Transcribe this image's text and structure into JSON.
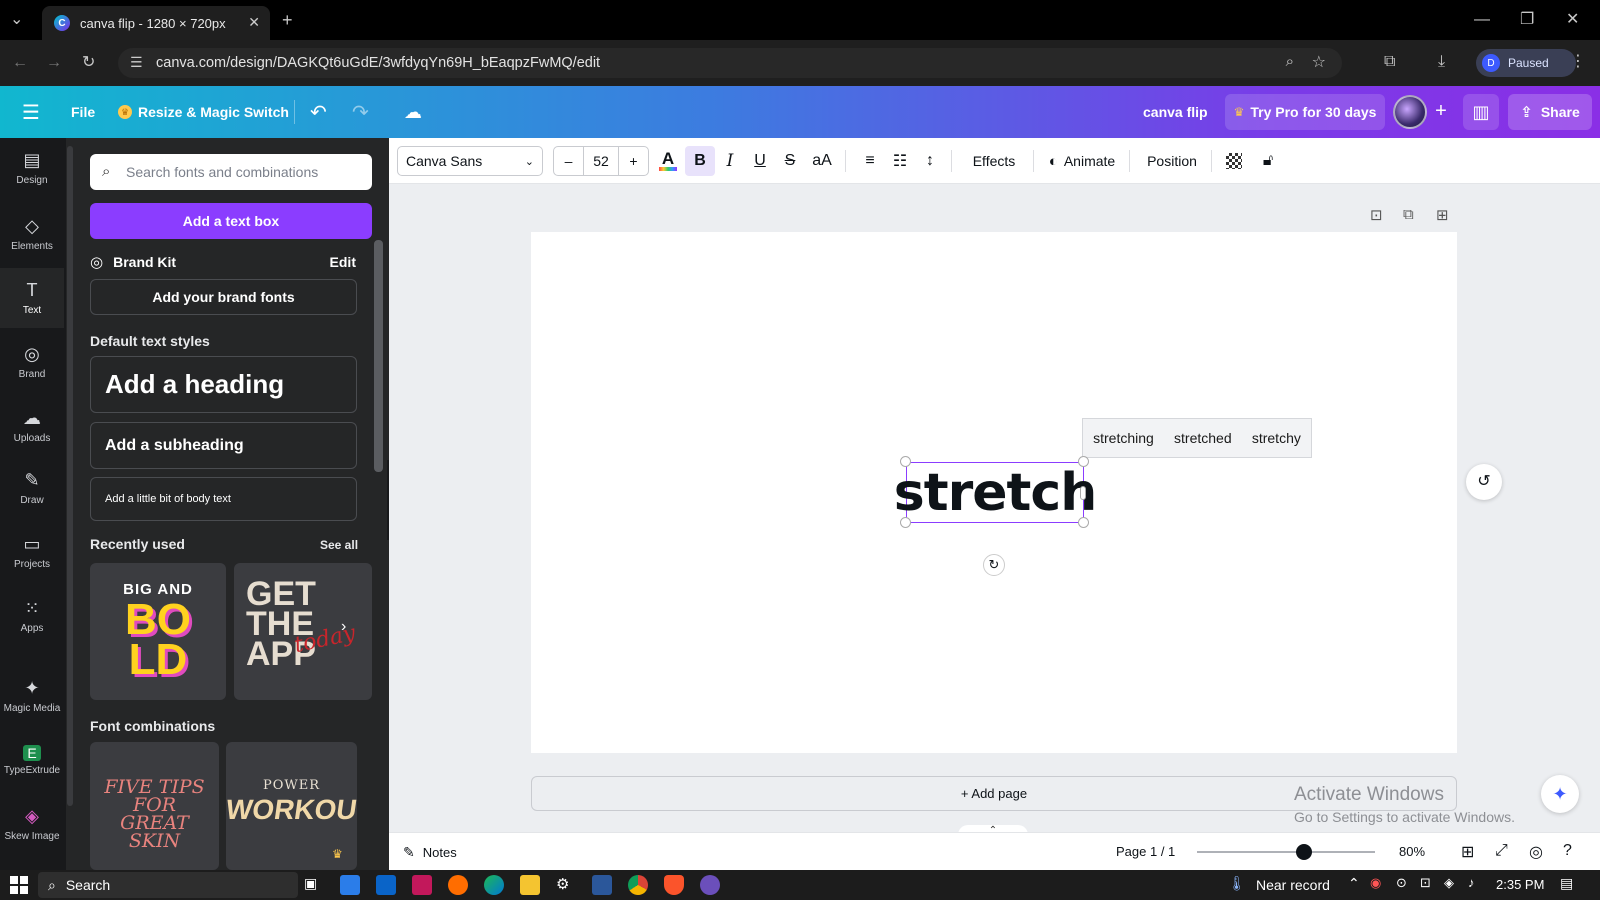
{
  "browser": {
    "tab_title": "canva flip - 1280 × 720px",
    "url": "canva.com/design/DAGKQt6uGdE/3wfdyqYn69H_bEaqpzFwMQ/edit",
    "profile_initial": "D",
    "profile_status": "Paused"
  },
  "header": {
    "file_label": "File",
    "resize_label": "Resize & Magic Switch",
    "design_title": "canva flip",
    "try_pro_label": "Try Pro for 30 days",
    "share_label": "Share"
  },
  "rail": [
    {
      "name": "design",
      "label": "Design",
      "icon": "▤"
    },
    {
      "name": "elements",
      "label": "Elements",
      "icon": "◇"
    },
    {
      "name": "text",
      "label": "Text",
      "icon": "T"
    },
    {
      "name": "brand",
      "label": "Brand",
      "icon": "◎"
    },
    {
      "name": "uploads",
      "label": "Uploads",
      "icon": "☁"
    },
    {
      "name": "draw",
      "label": "Draw",
      "icon": "✎"
    },
    {
      "name": "projects",
      "label": "Projects",
      "icon": "▭"
    },
    {
      "name": "apps",
      "label": "Apps",
      "icon": "⁙"
    },
    {
      "name": "magic-media",
      "label": "Magic Media",
      "icon": "✦"
    },
    {
      "name": "typeextrude",
      "label": "TypeExtrude",
      "icon": "E"
    },
    {
      "name": "skew-image",
      "label": "Skew Image",
      "icon": "◈"
    }
  ],
  "panel": {
    "search_placeholder": "Search fonts and combinations",
    "add_text_box": "Add a text box",
    "brand_kit": "Brand Kit",
    "brand_edit": "Edit",
    "add_brand_fonts": "Add your brand fonts",
    "default_styles": "Default text styles",
    "heading": "Add a heading",
    "subheading": "Add a subheading",
    "body": "Add a little bit of body text",
    "recently_used": "Recently used",
    "see_all": "See all",
    "thumb1_line1": "BIG AND",
    "thumb1_line2": "BO",
    "thumb1_line3": "LD",
    "thumb2_line1": "GET",
    "thumb2_line2": "THE",
    "thumb2_line3": "APP",
    "thumb2_script": "today",
    "font_combinations": "Font combinations",
    "combo1_text": "FIVE TIPS FOR GREAT SKIN",
    "combo2_top": "POWER",
    "combo2_main": "WORKOUT"
  },
  "toolbar": {
    "font_name": "Canva Sans",
    "font_size": "52",
    "minus": "–",
    "plus": "+",
    "effects": "Effects",
    "animate": "Animate",
    "position": "Position"
  },
  "canvas": {
    "text": "stretch",
    "suggestions": [
      "stretching",
      "stretched",
      "stretchy"
    ],
    "add_page": "+ Add page",
    "watermark_title": "Activate Windows",
    "watermark_sub": "Go to Settings to activate Windows."
  },
  "bottom": {
    "notes": "Notes",
    "page_indicator": "Page 1 / 1",
    "zoom": "80%",
    "zoom_fraction": 0.6
  },
  "taskbar": {
    "search": "Search",
    "weather": "Near record",
    "time": "2:35 PM"
  },
  "colors": {
    "accent": "#8b3dff",
    "panel_bg": "#252627",
    "rail_bg": "#18191b"
  }
}
